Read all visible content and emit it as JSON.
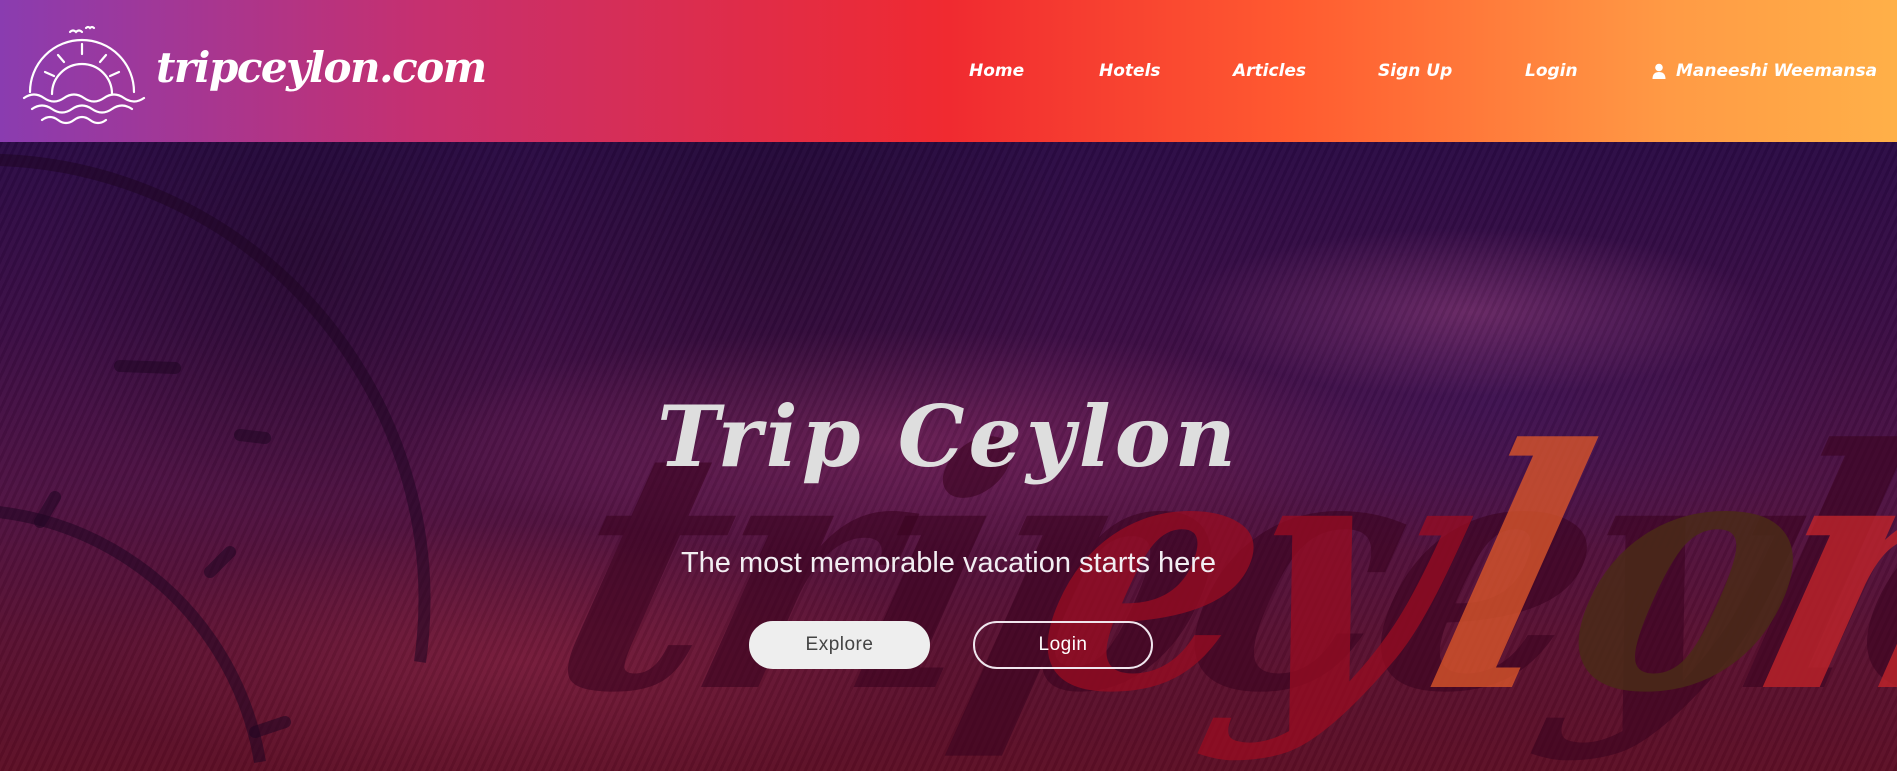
{
  "header": {
    "logo_text": "tripceylon.com",
    "nav": [
      {
        "label": "Home"
      },
      {
        "label": "Hotels"
      },
      {
        "label": "Articles"
      },
      {
        "label": "Sign Up"
      },
      {
        "label": "Login"
      }
    ],
    "user": {
      "name": "Maneeshi Weemansa",
      "icon": "user-icon"
    },
    "gradient_colors": [
      "#8a3cb0",
      "#c53070",
      "#f02a30",
      "#ff5a30",
      "#ff9a45",
      "#ffb048"
    ]
  },
  "hero": {
    "title": "Trip Ceylon",
    "subtitle": "The most memorable vacation starts here",
    "watermark_text": "tripceylon",
    "buttons": {
      "explore": "Explore",
      "login": "Login"
    }
  }
}
